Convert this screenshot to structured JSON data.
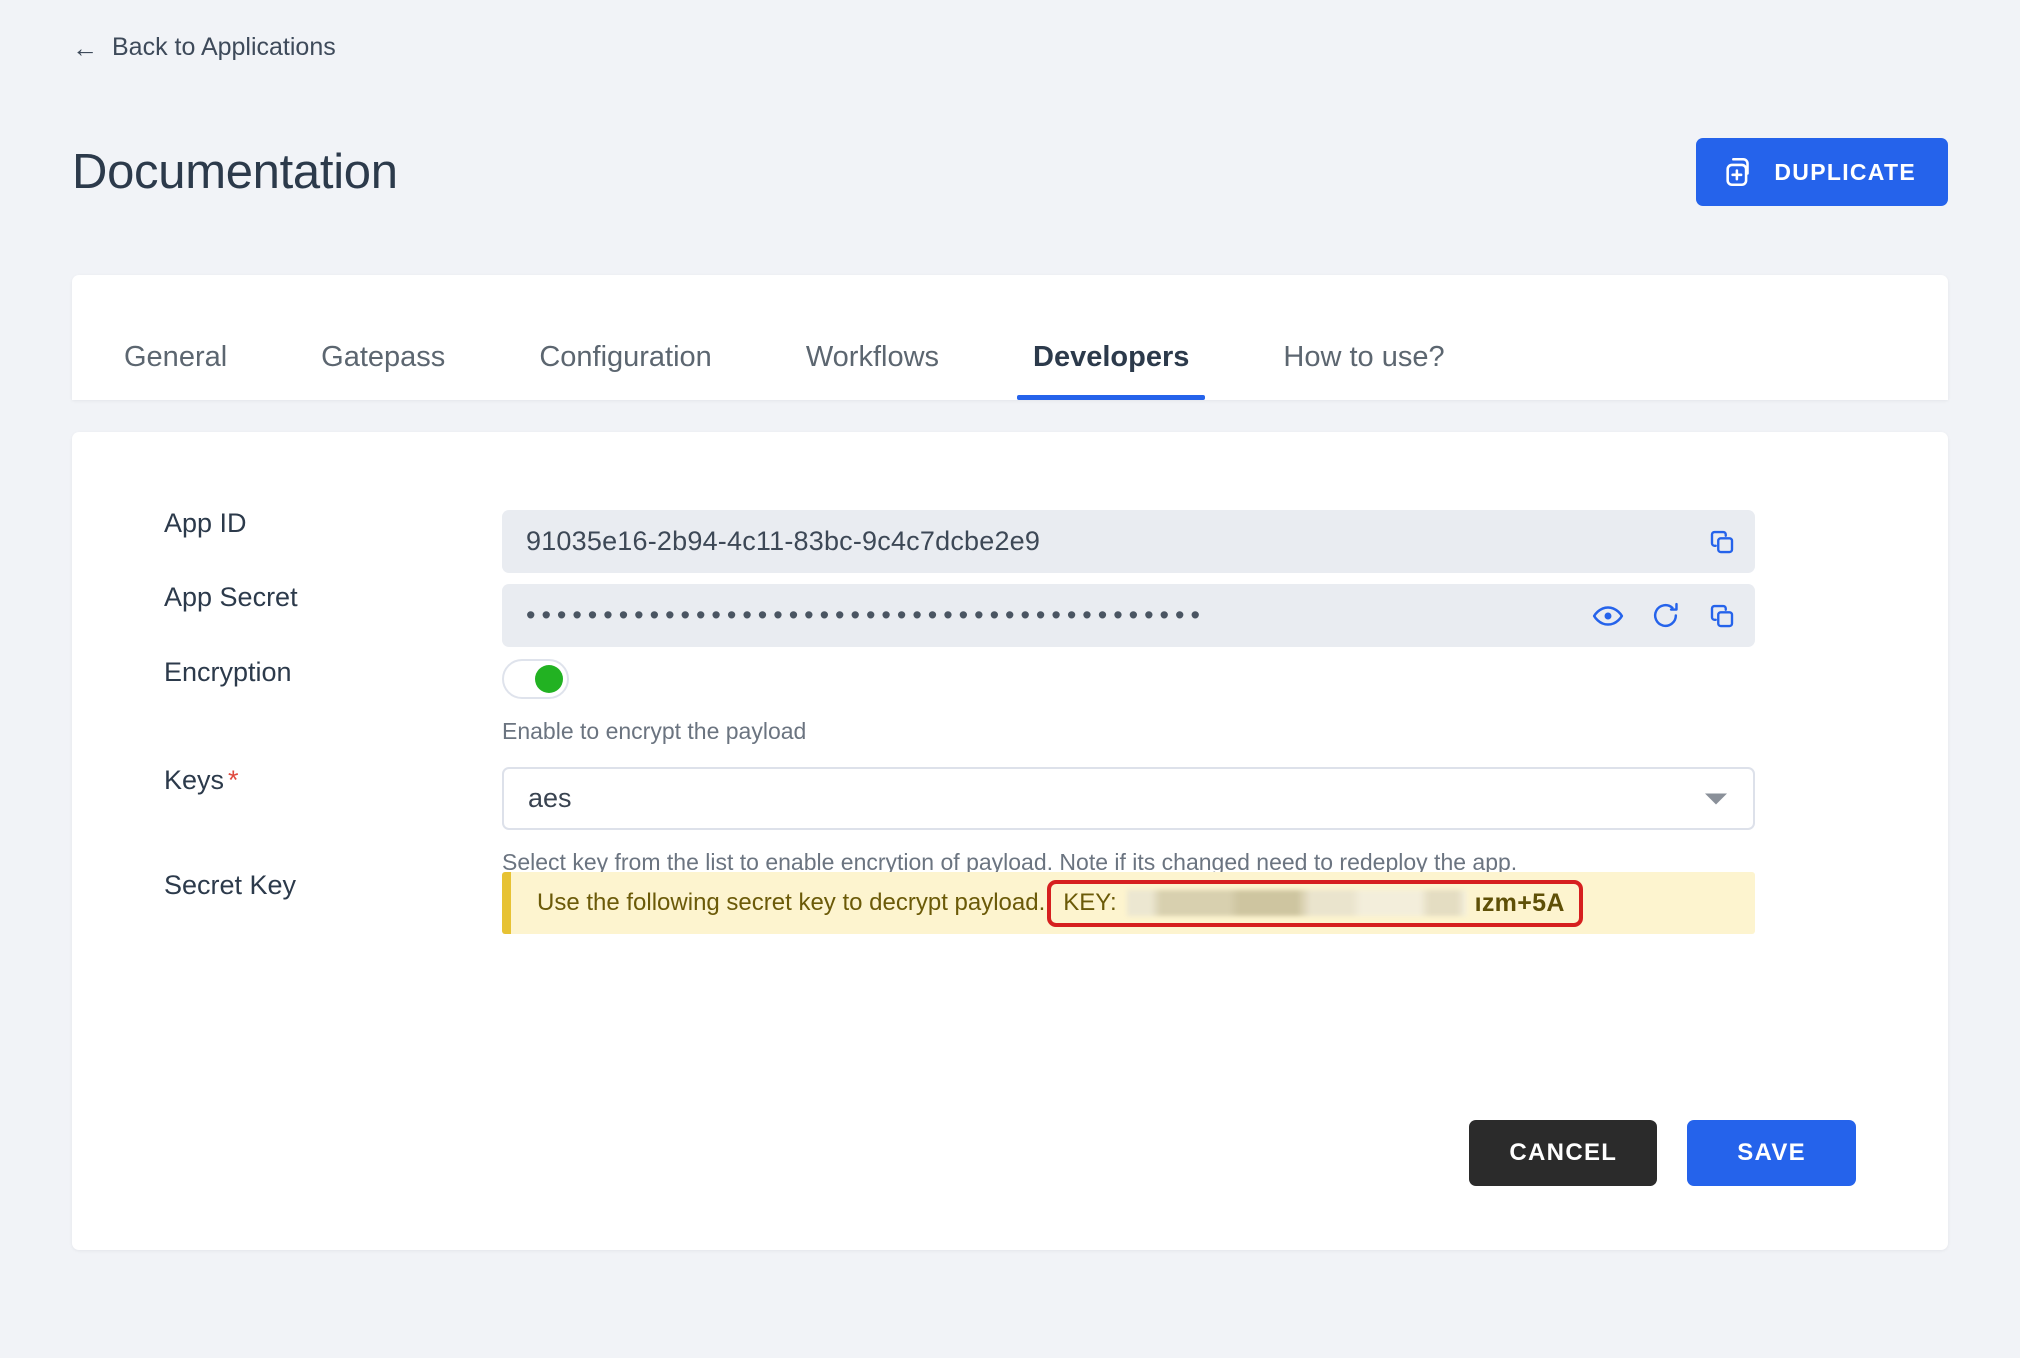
{
  "nav": {
    "back_label": "Back to Applications",
    "back_icon": "arrow-left-icon"
  },
  "header": {
    "title": "Documentation",
    "duplicate_label": "DUPLICATE",
    "duplicate_icon": "duplicate-icon"
  },
  "tabs": [
    {
      "label": "General",
      "active": false
    },
    {
      "label": "Gatepass",
      "active": false
    },
    {
      "label": "Configuration",
      "active": false
    },
    {
      "label": "Workflows",
      "active": false
    },
    {
      "label": "Developers",
      "active": true
    },
    {
      "label": "How to use?",
      "active": false
    }
  ],
  "form": {
    "app_id": {
      "label": "App ID",
      "value": "91035e16-2b94-4c11-83bc-9c4c7dcbe2e9",
      "copy_icon": "copy-icon"
    },
    "app_secret": {
      "label": "App Secret",
      "value": "••••••••••••••••••••••••••••••••••••••••••••",
      "reveal_icon": "eye-icon",
      "regenerate_icon": "refresh-icon",
      "copy_icon": "copy-icon"
    },
    "encryption": {
      "label": "Encryption",
      "enabled": true,
      "helper": "Enable to encrypt the payload"
    },
    "keys": {
      "label": "Keys",
      "required_marker": "*",
      "value": "aes",
      "options": [
        "aes"
      ],
      "helper": "Select key from the list to enable encrytion of payload. Note if its changed need to redeploy the app.",
      "dropdown_icon": "chevron-down-icon"
    },
    "secret_key": {
      "label": "Secret Key",
      "banner_text": "Use the following secret key to decrypt payload.",
      "key_label": "KEY:",
      "key_value_redacted": true,
      "key_value_tail": "ızm+5A"
    }
  },
  "actions": {
    "cancel_label": "CANCEL",
    "save_label": "SAVE"
  },
  "colors": {
    "accent_blue": "#2563eb",
    "page_background": "#f1f3f7",
    "toggle_on_green": "#22b222",
    "banner_background": "#fdf4cf",
    "banner_border": "#e7c233",
    "annotation_red": "#d61f1f",
    "cancel_dark": "#2b2b2b",
    "required_red": "#e04a3f"
  }
}
